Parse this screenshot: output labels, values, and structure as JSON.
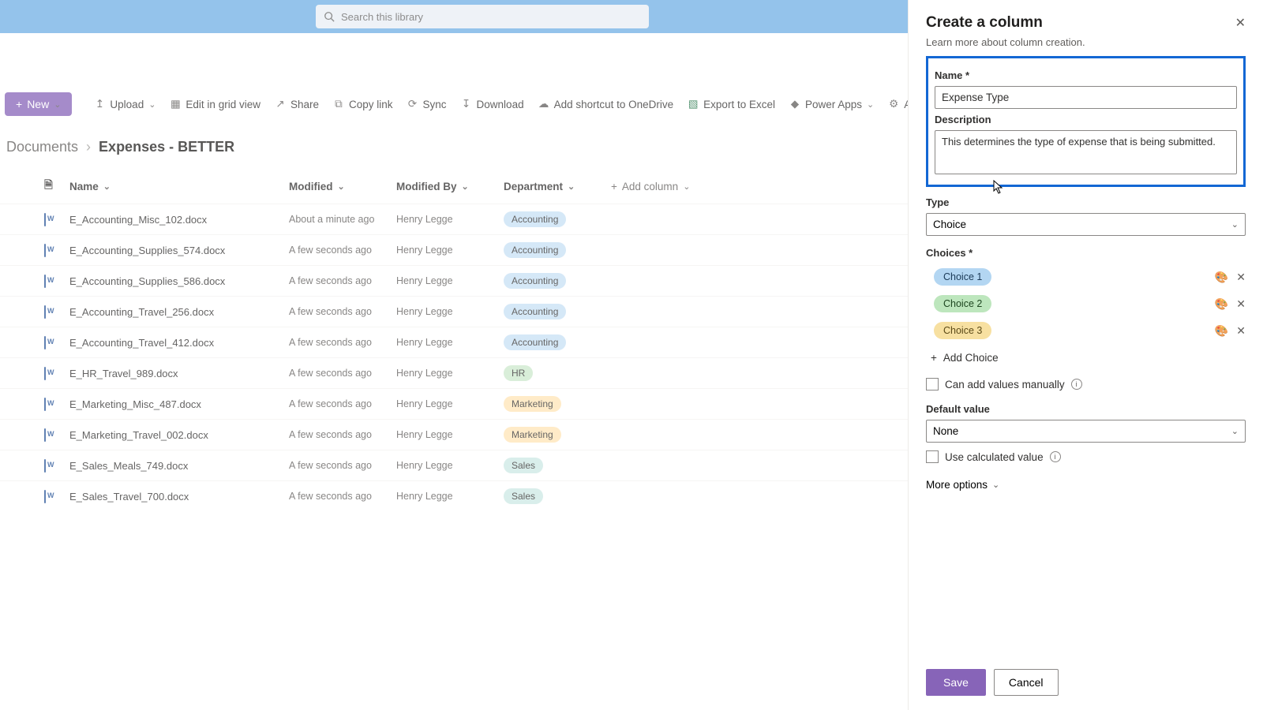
{
  "search": {
    "placeholder": "Search this library"
  },
  "cmdbar": {
    "new": "New",
    "upload": "Upload",
    "editgrid": "Edit in grid view",
    "share": "Share",
    "copylink": "Copy link",
    "sync": "Sync",
    "download": "Download",
    "shortcut": "Add shortcut to OneDrive",
    "excel": "Export to Excel",
    "powerapps": "Power Apps",
    "automate": "Automate"
  },
  "breadcrumb": {
    "root": "Documents",
    "current": "Expenses - BETTER"
  },
  "columns": {
    "name": "Name",
    "modified": "Modified",
    "modifiedBy": "Modified By",
    "department": "Department",
    "add": "Add column"
  },
  "rows": [
    {
      "name": "E_Accounting_Misc_102.docx",
      "modified": "About a minute ago",
      "by": "Henry Legge",
      "dept": "Accounting",
      "deptClass": "pill-acc"
    },
    {
      "name": "E_Accounting_Supplies_574.docx",
      "modified": "A few seconds ago",
      "by": "Henry Legge",
      "dept": "Accounting",
      "deptClass": "pill-acc"
    },
    {
      "name": "E_Accounting_Supplies_586.docx",
      "modified": "A few seconds ago",
      "by": "Henry Legge",
      "dept": "Accounting",
      "deptClass": "pill-acc"
    },
    {
      "name": "E_Accounting_Travel_256.docx",
      "modified": "A few seconds ago",
      "by": "Henry Legge",
      "dept": "Accounting",
      "deptClass": "pill-acc"
    },
    {
      "name": "E_Accounting_Travel_412.docx",
      "modified": "A few seconds ago",
      "by": "Henry Legge",
      "dept": "Accounting",
      "deptClass": "pill-acc"
    },
    {
      "name": "E_HR_Travel_989.docx",
      "modified": "A few seconds ago",
      "by": "Henry Legge",
      "dept": "HR",
      "deptClass": "pill-hr"
    },
    {
      "name": "E_Marketing_Misc_487.docx",
      "modified": "A few seconds ago",
      "by": "Henry Legge",
      "dept": "Marketing",
      "deptClass": "pill-mkt"
    },
    {
      "name": "E_Marketing_Travel_002.docx",
      "modified": "A few seconds ago",
      "by": "Henry Legge",
      "dept": "Marketing",
      "deptClass": "pill-mkt"
    },
    {
      "name": "E_Sales_Meals_749.docx",
      "modified": "A few seconds ago",
      "by": "Henry Legge",
      "dept": "Sales",
      "deptClass": "pill-sales"
    },
    {
      "name": "E_Sales_Travel_700.docx",
      "modified": "A few seconds ago",
      "by": "Henry Legge",
      "dept": "Sales",
      "deptClass": "pill-sales"
    }
  ],
  "panel": {
    "title": "Create a column",
    "subtitle": "Learn more about column creation.",
    "nameLabel": "Name *",
    "nameValue": "Expense Type",
    "descLabel": "Description",
    "descValue": "This determines the type of expense that is being submitted.",
    "typeLabel": "Type",
    "typeValue": "Choice",
    "choicesLabel": "Choices *",
    "choices": [
      "Choice 1",
      "Choice 2",
      "Choice 3"
    ],
    "addChoice": "Add Choice",
    "canAdd": "Can add values manually",
    "defaultLabel": "Default value",
    "defaultValue": "None",
    "useCalc": "Use calculated value",
    "moreOptions": "More options",
    "save": "Save",
    "cancel": "Cancel"
  }
}
